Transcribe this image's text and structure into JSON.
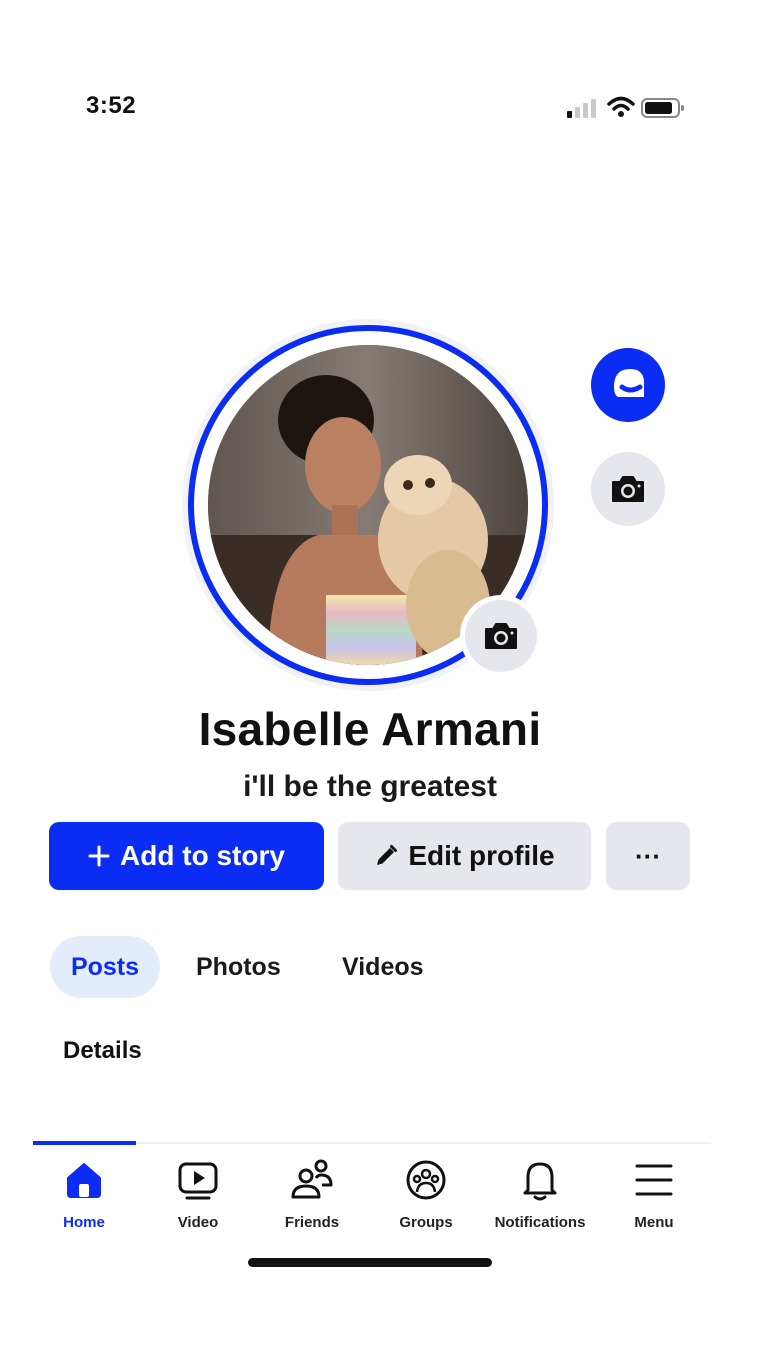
{
  "status_bar": {
    "time": "3:52",
    "signal_icon": "cellular-signal-icon",
    "wifi_icon": "wifi-icon",
    "battery_icon": "battery-icon"
  },
  "profile": {
    "name": "Isabelle Armani",
    "bio": "i'll be the greatest",
    "avatar_icon": "profile-photo",
    "story_ring_color": "#0b2cf2"
  },
  "actions": {
    "add_story_label": "Add to story",
    "edit_profile_label": "Edit profile",
    "more_label": "···"
  },
  "tabs": [
    {
      "label": "Posts",
      "active": true
    },
    {
      "label": "Photos",
      "active": false
    },
    {
      "label": "Videos",
      "active": false
    }
  ],
  "section_heading": "Details",
  "bottom_nav": [
    {
      "label": "Home",
      "icon": "home-icon",
      "active": true
    },
    {
      "label": "Video",
      "icon": "video-icon",
      "active": false
    },
    {
      "label": "Friends",
      "icon": "friends-icon",
      "active": false
    },
    {
      "label": "Groups",
      "icon": "groups-icon",
      "active": false
    },
    {
      "label": "Notifications",
      "icon": "bell-icon",
      "active": false
    },
    {
      "label": "Menu",
      "icon": "menu-icon",
      "active": false
    }
  ],
  "colors": {
    "accent": "#0b2cf2",
    "button_gray": "#e6e7ec",
    "tab_active_bg": "#e4ecfb"
  }
}
